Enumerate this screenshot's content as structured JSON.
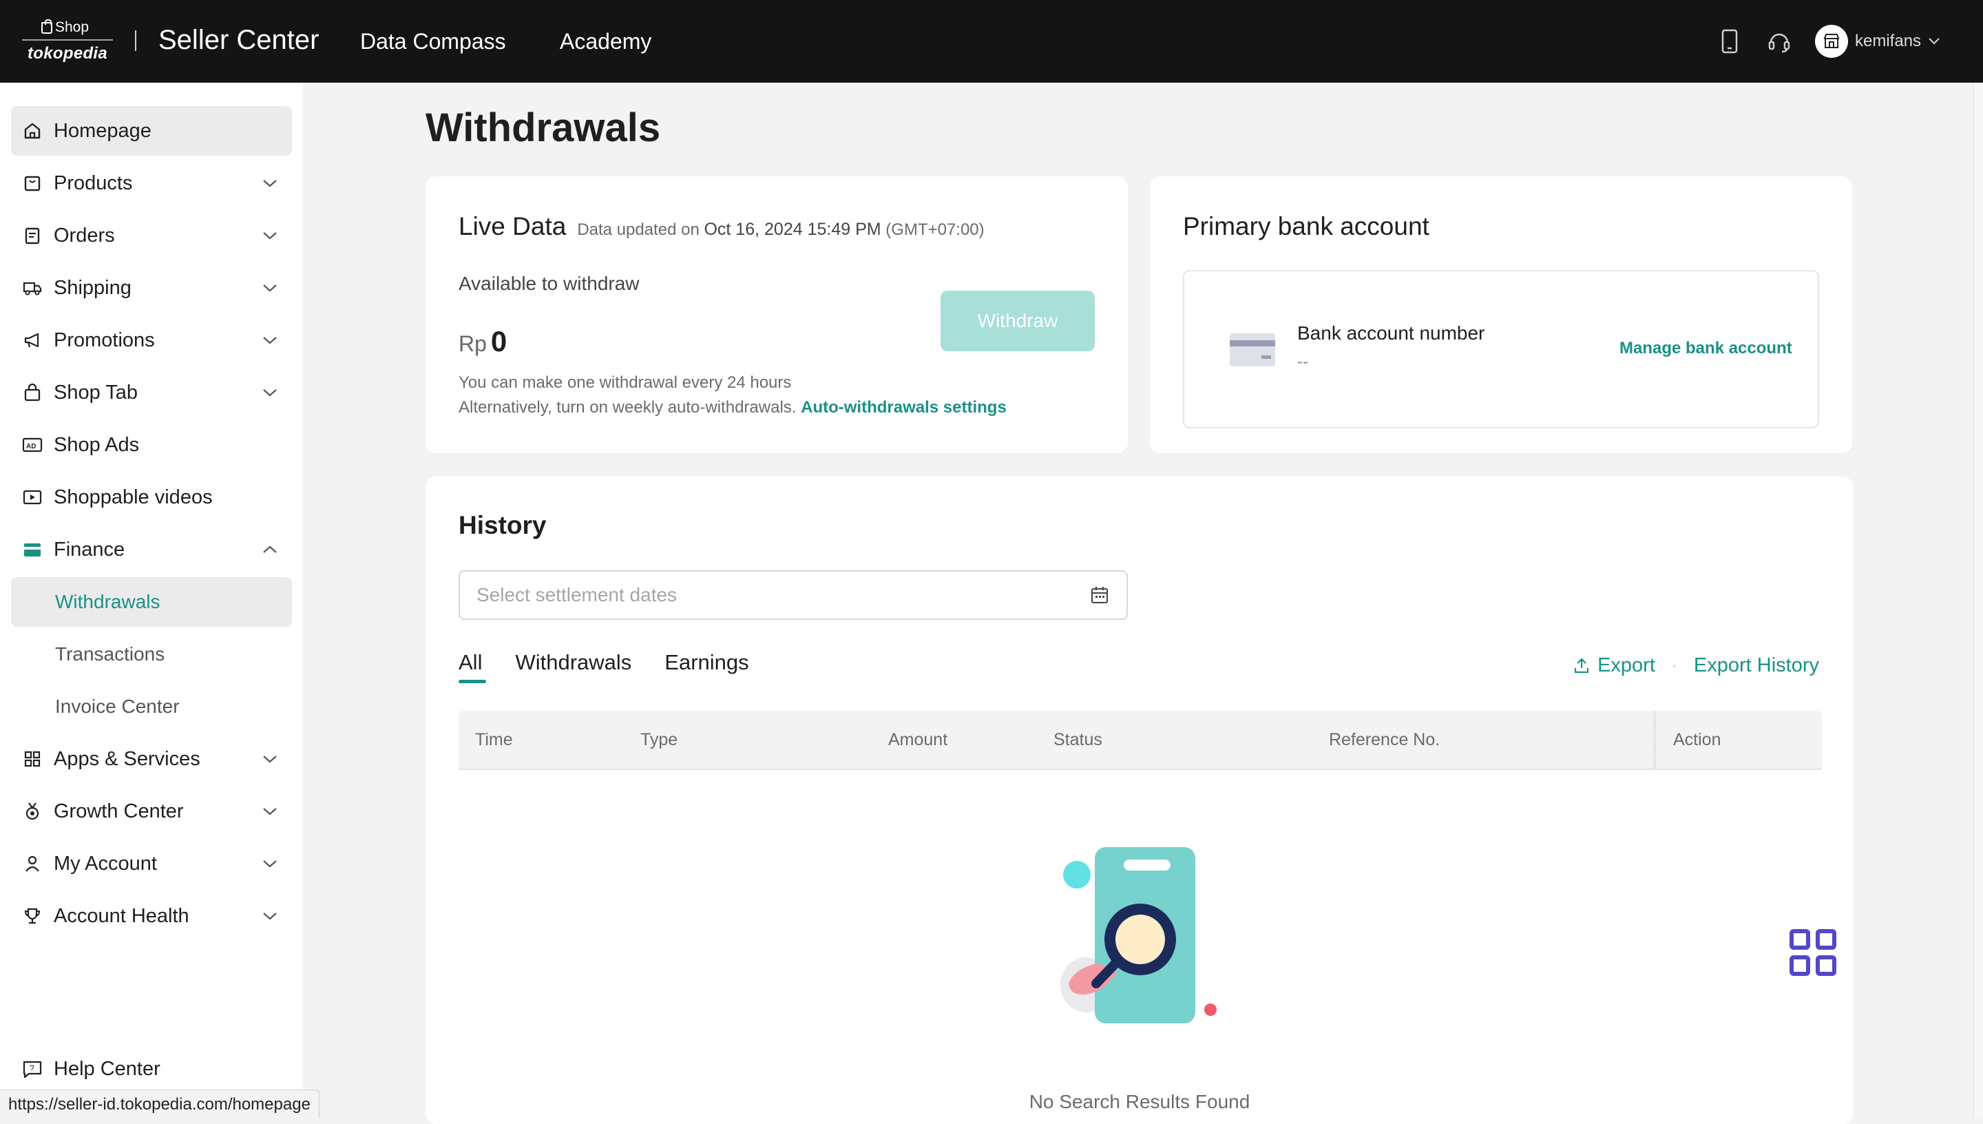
{
  "topbar": {
    "logo_shop": "Shop",
    "logo_brand": "tokopedia",
    "app_title": "Seller Center",
    "nav": [
      "Data Compass",
      "Academy"
    ],
    "username": "kemifans",
    "icons": [
      "phone-icon",
      "headset-icon",
      "store-icon",
      "chevron-down-icon"
    ]
  },
  "sidebar": {
    "items": [
      {
        "label": "Homepage",
        "icon": "home-icon"
      },
      {
        "label": "Products",
        "icon": "box-icon"
      },
      {
        "label": "Orders",
        "icon": "clipboard-icon"
      },
      {
        "label": "Shipping",
        "icon": "truck-icon"
      },
      {
        "label": "Promotions",
        "icon": "megaphone-icon"
      },
      {
        "label": "Shop Tab",
        "icon": "shopping-bag-icon"
      },
      {
        "label": "Shop Ads",
        "icon": "ads-icon"
      },
      {
        "label": "Shoppable videos",
        "icon": "video-icon"
      },
      {
        "label": "Finance",
        "icon": "wallet-icon"
      },
      {
        "label": "Apps & Services",
        "icon": "apps-icon"
      },
      {
        "label": "Growth Center",
        "icon": "medal-icon"
      },
      {
        "label": "My Account",
        "icon": "user-icon"
      },
      {
        "label": "Account Health",
        "icon": "trophy-icon"
      }
    ],
    "finance_sub": [
      "Withdrawals",
      "Transactions",
      "Invoice Center"
    ],
    "help": "Help Center"
  },
  "status_url": "https://seller-id.tokopedia.com/homepage",
  "page": {
    "title": "Withdrawals",
    "live": {
      "heading": "Live Data",
      "updated_prefix": "Data updated on",
      "updated_time": "Oct 16, 2024 15:49 PM",
      "tz": "(GMT+07:00)",
      "available_label": "Available to withdraw",
      "currency": "Rp",
      "amount": "0",
      "withdraw_button": "Withdraw",
      "note1": "You can make one withdrawal every 24 hours",
      "note2": "Alternatively, turn on weekly auto-withdrawals.",
      "note2_link": "Auto-withdrawals settings"
    },
    "bank": {
      "heading": "Primary bank account",
      "number_label": "Bank account number",
      "number_value": "--",
      "manage_link": "Manage bank account"
    },
    "history": {
      "heading": "History",
      "date_placeholder": "Select settlement dates",
      "tabs": [
        "All",
        "Withdrawals",
        "Earnings"
      ],
      "export": "Export",
      "export_history": "Export History",
      "columns": [
        "Time",
        "Type",
        "Amount",
        "Status",
        "Reference No.",
        "Action"
      ],
      "empty_text": "No Search Results Found"
    }
  },
  "colors": {
    "accent": "#1a9187",
    "withdraw_disabled": "#a8dfd9",
    "topbar": "#141414",
    "grid_widget": "#5148c9"
  }
}
